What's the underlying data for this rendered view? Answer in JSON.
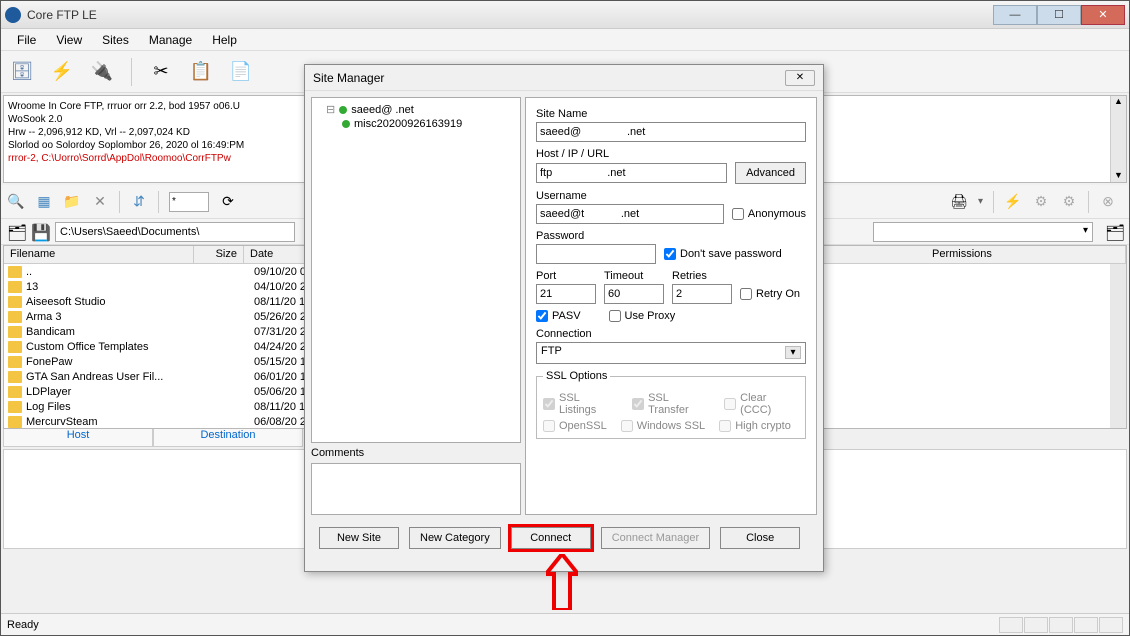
{
  "app_title": "Core FTP LE",
  "menu": {
    "file": "File",
    "view": "View",
    "sites": "Sites",
    "manage": "Manage",
    "help": "Help"
  },
  "log": {
    "l1": "Wroome In Core FTP, rrruor orr 2.2, bod 1957  o06.U",
    "l2": "WoSook 2.0",
    "l3": "Hrw -- 2,096,912 KD, Vrl -- 2,097,024 KD",
    "l4": "Slorlod oo Solordoy Soplombor 26, 2020 ol 16:49:PM",
    "l5": "rrror-2, C:\\Uorro\\Sorrd\\AppDol\\Roomoo\\CorrFTPw"
  },
  "action": {
    "filter_value": "*"
  },
  "path": {
    "value": "C:\\Users\\Saeed\\Documents\\"
  },
  "columns": {
    "name": "Filename",
    "size": "Size",
    "date": "Date",
    "perm": "Permissions"
  },
  "files": [
    {
      "name": "..",
      "size": "",
      "date": "09/10/20",
      "ext": "0"
    },
    {
      "name": "13",
      "size": "",
      "date": "04/10/20",
      "ext": "2"
    },
    {
      "name": "Aiseesoft Studio",
      "size": "",
      "date": "08/11/20",
      "ext": "1"
    },
    {
      "name": "Arma 3",
      "size": "",
      "date": "05/26/20",
      "ext": "2"
    },
    {
      "name": "Bandicam",
      "size": "",
      "date": "07/31/20",
      "ext": "2"
    },
    {
      "name": "Custom Office Templates",
      "size": "",
      "date": "04/24/20",
      "ext": "2"
    },
    {
      "name": "FonePaw",
      "size": "",
      "date": "05/15/20",
      "ext": "1"
    },
    {
      "name": "GTA San Andreas User Fil...",
      "size": "",
      "date": "06/01/20",
      "ext": "1"
    },
    {
      "name": "LDPlayer",
      "size": "",
      "date": "05/06/20",
      "ext": "1"
    },
    {
      "name": "Log Files",
      "size": "",
      "date": "08/11/20",
      "ext": "1"
    },
    {
      "name": "MercurvSteam",
      "size": "",
      "date": "06/08/20",
      "ext": "2"
    }
  ],
  "tabs": {
    "host": "Host",
    "dest": "Destination"
  },
  "status": {
    "ready": "Ready"
  },
  "dialog": {
    "title": "Site Manager",
    "tree": {
      "n1": "saeed@               .net",
      "n2": "misc20200926163919"
    },
    "comments_label": "Comments",
    "labels": {
      "site_name": "Site Name",
      "host": "Host / IP / URL",
      "advanced": "Advanced",
      "username": "Username",
      "anonymous": "Anonymous",
      "password": "Password",
      "dont_save": "Don't save password",
      "port": "Port",
      "timeout": "Timeout",
      "retries": "Retries",
      "retry_on": "Retry On",
      "pasv": "PASV",
      "use_proxy": "Use Proxy",
      "connection": "Connection",
      "ssl_options": "SSL Options",
      "ssl_listings": "SSL Listings",
      "ssl_transfer": "SSL Transfer",
      "clear_ccc": "Clear (CCC)",
      "openssl": "OpenSSL",
      "windows_ssl": "Windows SSL",
      "high_crypto": "High crypto"
    },
    "values": {
      "site_name": "saeed@               .net",
      "host": "ftp                  .net",
      "username": "saeed@t            .net",
      "password": "",
      "port": "21",
      "timeout": "60",
      "retries": "2",
      "connection": "FTP"
    },
    "buttons": {
      "new_site": "New Site",
      "new_category": "New Category",
      "connect": "Connect",
      "connect_manager": "Connect Manager",
      "close": "Close"
    }
  }
}
